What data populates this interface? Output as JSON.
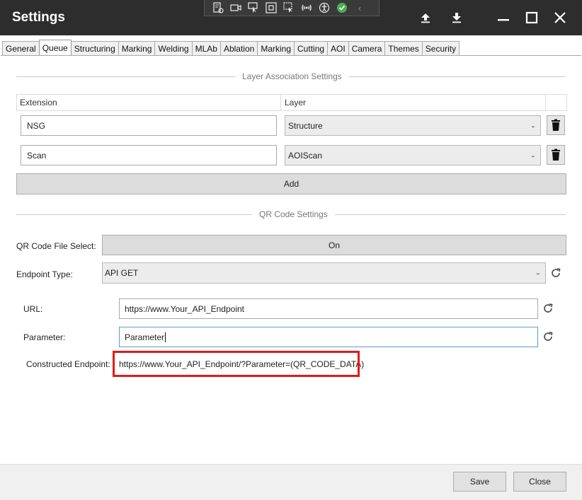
{
  "window": {
    "title": "Settings",
    "toolbar_icons": [
      "settings-document-icon",
      "video-camera-icon",
      "select-pointer-icon",
      "frame-icon",
      "region-select-icon",
      "wireless-icon",
      "accessibility-icon",
      "check-circle-icon",
      "chevron-left-icon"
    ],
    "controls": [
      "upload-icon",
      "download-icon",
      "minimize-icon",
      "maximize-icon",
      "close-icon"
    ]
  },
  "tabs": [
    {
      "label": "General",
      "active": false
    },
    {
      "label": "Queue",
      "active": true
    },
    {
      "label": "Structuring",
      "active": false
    },
    {
      "label": "Marking",
      "active": false
    },
    {
      "label": "Welding",
      "active": false
    },
    {
      "label": "MLAb",
      "active": false
    },
    {
      "label": "Ablation",
      "active": false
    },
    {
      "label": "Marking",
      "active": false
    },
    {
      "label": "Cutting",
      "active": false
    },
    {
      "label": "AOI",
      "active": false
    },
    {
      "label": "Camera",
      "active": false
    },
    {
      "label": "Themes",
      "active": false
    },
    {
      "label": "Security",
      "active": false
    }
  ],
  "layer_association": {
    "section_title": "Layer Association Settings",
    "columns": [
      "Extension",
      "Layer"
    ],
    "rows": [
      {
        "extension": "NSG",
        "layer": "Structure"
      },
      {
        "extension": "Scan",
        "layer": "AOIScan"
      }
    ],
    "add_label": "Add"
  },
  "qr_code": {
    "section_title": "QR Code Settings",
    "file_select_label": "QR Code File Select:",
    "file_select_value": "On",
    "endpoint_type_label": "Endpoint Type:",
    "endpoint_type_value": "API GET",
    "url_label": "URL:",
    "url_value": "https://www.Your_API_Endpoint",
    "parameter_label": "Parameter:",
    "parameter_value": "Parameter",
    "constructed_label": "Constructed Endpoint:",
    "constructed_value": "https://www.Your_API_Endpoint/?Parameter=(QR_CODE_DATA)"
  },
  "footer": {
    "save_label": "Save",
    "close_label": "Close"
  },
  "colors": {
    "titlebar": "#2d2d2d",
    "highlight": "#e11a1a",
    "focus_border": "#5b9bd5"
  }
}
